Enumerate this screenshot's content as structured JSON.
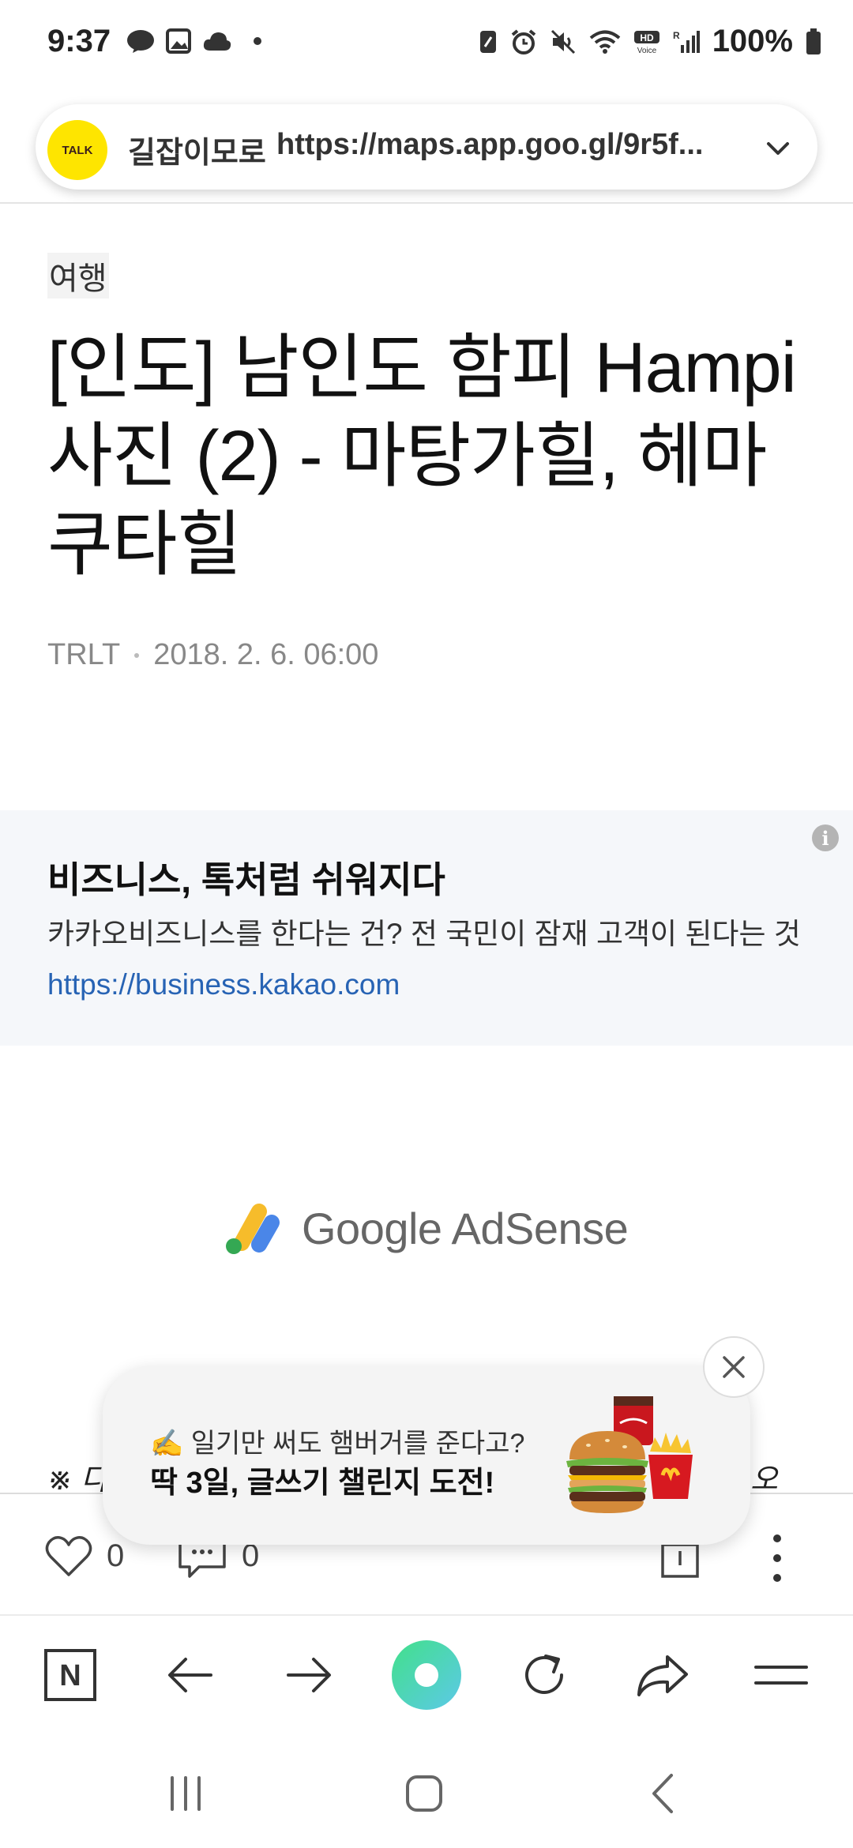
{
  "status_bar": {
    "time": "9:37",
    "battery": "100%",
    "left_icons": [
      "talk-icon",
      "gallery-icon",
      "cloud-icon",
      "dot-icon"
    ],
    "right_icons": [
      "nfc-icon",
      "alarm-icon",
      "mute-icon",
      "wifi-icon",
      "hd-voice-icon",
      "signal-icon",
      "battery-icon"
    ]
  },
  "url_bar": {
    "badge": "TALK",
    "title": "길잡이모로",
    "url": "https://maps.app.goo.gl/9r5f..."
  },
  "article": {
    "category": "여행",
    "title": "[인도] 남인도 함피 Hampi 사진 (2) - 마탕가힐, 헤마쿠타힐",
    "author": "TRLT",
    "date": "2018. 2. 6. 06:00"
  },
  "ad": {
    "headline": "비즈니스, 톡처럼 쉬워지다",
    "description": "카카오비즈니스를 한다는 건? 전 국민이 잠재 고객이 된다는 것",
    "link": "https://business.kakao.com",
    "info_glyph": "i"
  },
  "adsense": {
    "label": "Google AdSense"
  },
  "partial_text": {
    "left": "※ 다",
    "right": "오"
  },
  "popup": {
    "subtitle": "✍️ 일기만 써도 햄버거를 준다고?",
    "title": "딱 3일, 글쓰기 챌린지 도전!"
  },
  "reactions": {
    "likes": "0",
    "comments": "0"
  },
  "browser_nav": {
    "items": [
      "naver-home-icon",
      "back-arrow-icon",
      "forward-arrow-icon",
      "green-dot-icon",
      "refresh-icon",
      "share-arrow-icon",
      "menu-icon"
    ],
    "home_letter": "N"
  },
  "colors": {
    "kakao_yellow": "#FEE500",
    "link_blue": "#2763b4",
    "green_accent": "#3ddc84"
  }
}
